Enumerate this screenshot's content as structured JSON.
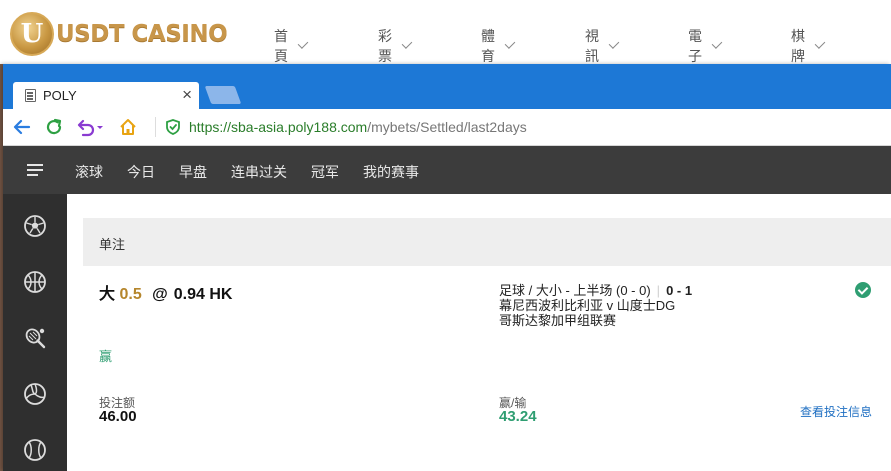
{
  "site": {
    "logo_text": "USDT CASINO",
    "logo_letter": "U",
    "nav": [
      "首頁",
      "彩票",
      "體育",
      "視訊",
      "電子",
      "棋牌"
    ]
  },
  "browser": {
    "tab_title": "POLY",
    "tab_close": "×",
    "url_host": "https://sba-asia.poly188.com",
    "url_path": "/mybets/Settled/last2days"
  },
  "sportsbook": {
    "tabs": [
      "滚球",
      "今日",
      "早盘",
      "连串过关",
      "冠军",
      "我的赛事"
    ],
    "sidebar_icons": [
      "soccer-ball-icon",
      "basketball-icon",
      "tennis-icon",
      "volleyball-icon",
      "baseball-icon"
    ]
  },
  "bet": {
    "type_header": "单注",
    "pick": "大",
    "handicap": "0.5",
    "at": "@",
    "odds": "0.94 HK",
    "market": "足球 / 大小 - 上半场 (0 - 0)",
    "pipe": "|",
    "score": "0 - 1",
    "match": "幕尼西波利比利亚 v 山度士DG",
    "league": "哥斯达黎加甲组联赛",
    "status": "赢",
    "stake_label": "投注额",
    "stake_value": "46.00",
    "winloss_label": "赢/输",
    "winloss_value": "43.24",
    "detail_link": "查看投注信息"
  },
  "colors": {
    "brand_gold": "#c8964a",
    "browser_blue": "#1d78d6",
    "win_green": "#2f9e72",
    "dark_nav": "#3c3c3c"
  }
}
